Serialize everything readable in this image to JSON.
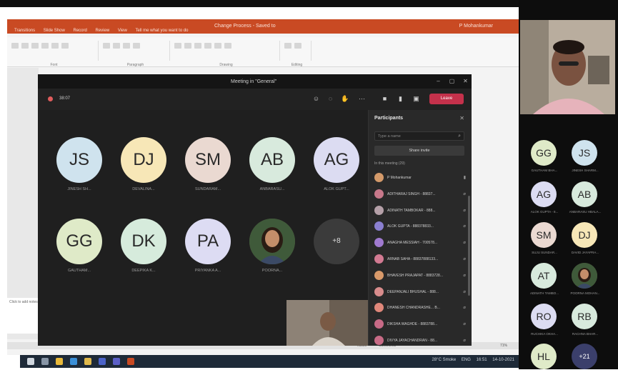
{
  "powerpoint": {
    "title": "Change Process - Saved to",
    "user": "P Mohankumar",
    "tabs": [
      "Transitions",
      "Slide Show",
      "Record",
      "Review",
      "View",
      "Tell me what you want to do"
    ],
    "ribbon_groups": [
      "Font",
      "Paragraph",
      "Drawing",
      "Editing"
    ],
    "notes_text": "Click to add notes",
    "status": [
      "Notes",
      "Comments",
      "71%"
    ]
  },
  "teams": {
    "window_title": "Meeting in \"General\"",
    "timer": "38:07",
    "leave_label": "Leave",
    "tiles": [
      {
        "initials": "JS",
        "name": "JINESH SH...",
        "color": "#cfe3ee"
      },
      {
        "initials": "DJ",
        "name": "DEVALINA...",
        "color": "#f7e7b7"
      },
      {
        "initials": "SM",
        "name": "SUNDARAM...",
        "color": "#ead9d1"
      },
      {
        "initials": "AB",
        "name": "ANBARASU...",
        "color": "#d8eadd"
      },
      {
        "initials": "AG",
        "name": "ALOK GUPT...",
        "color": "#dcdcf2"
      },
      {
        "initials": "GG",
        "name": "GAUTHAM...",
        "color": "#dfeac8"
      },
      {
        "initials": "DK",
        "name": "DEEPIKA K...",
        "color": "#d6ebdc"
      },
      {
        "initials": "PA",
        "name": "PRIYANKA A...",
        "color": "#dddcf3"
      },
      {
        "initials": "",
        "name": "POORNA...",
        "color": "#6b5a47"
      },
      {
        "initials": "+8",
        "name": "",
        "color": "#3b3b3b"
      }
    ],
    "participants_panel": {
      "title": "Participants",
      "search_placeholder": "Type a name",
      "share_invite": "Share invite",
      "section": "In this meeting (29)",
      "people": [
        {
          "name": "P Mohankumar",
          "color": "#d49a6a"
        },
        {
          "name": "ADITHARAJ SINGH - 88837...",
          "color": "#c7788a"
        },
        {
          "name": "ADINATH TAMBOKAR - 888...",
          "color": "#b5a0a8"
        },
        {
          "name": "ALOK GUPTA - 888378833...",
          "color": "#8a7fd0"
        },
        {
          "name": "ANAGHA MESSIAH - 700578...",
          "color": "#a07ad0"
        },
        {
          "name": "ARNAB SAHA - 88837888133...",
          "color": "#d27a92"
        },
        {
          "name": "BHAVESH PRAJAPAT - 8883728...",
          "color": "#d99a6a"
        },
        {
          "name": "DEEPANJALI BHUSHAL - 888...",
          "color": "#d88c8c"
        },
        {
          "name": "DHANESH CHANDRASHE... B...",
          "color": "#e0877a"
        },
        {
          "name": "DIKSHA WAGHDE - 8883788...",
          "color": "#c76a86"
        },
        {
          "name": "DIVYA JAYACHANDRAN - 88...",
          "color": "#c86b86"
        }
      ]
    }
  },
  "gallery": {
    "tiles": [
      {
        "initials": "GG",
        "name": "GAUTHAM BHA...",
        "color": "#dfeac8"
      },
      {
        "initials": "JS",
        "name": "JINESH SHARM...",
        "color": "#cfe3ee"
      },
      {
        "initials": "AG",
        "name": "ALOK GUPTA - 8...",
        "color": "#dcdcf2"
      },
      {
        "initials": "AB",
        "name": "ANBARASU HBALA...",
        "color": "#d8eadd"
      },
      {
        "initials": "SM",
        "name": "SUJU SUNDAR...",
        "color": "#ead9d1"
      },
      {
        "initials": "DJ",
        "name": "DAVID JAYAPRA...",
        "color": "#f7e7b7"
      },
      {
        "initials": "AT",
        "name": "ADINATH TAMBO...",
        "color": "#d8eadd"
      },
      {
        "initials": "",
        "name": "POORNA MOHAN...",
        "color": "#6b5a47"
      },
      {
        "initials": "RO",
        "name": "RUCHIKA OKHA...",
        "color": "#dcdcf2"
      },
      {
        "initials": "RB",
        "name": "RACHNA BHAR...",
        "color": "#d8eadd"
      },
      {
        "initials": "HL",
        "name": "",
        "color": "#dfeac8"
      },
      {
        "initials": "+21",
        "name": "",
        "color": "#3b3f6b"
      }
    ]
  },
  "taskbar": {
    "weather": "28°C Smoke",
    "time": "16:51",
    "date": "14-10-2021",
    "lang": "ENG"
  }
}
